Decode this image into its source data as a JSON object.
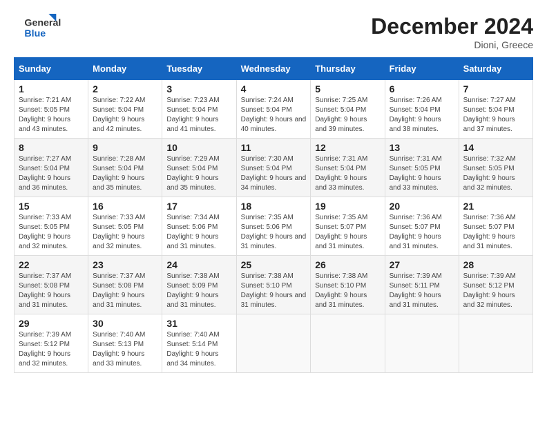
{
  "header": {
    "logo_general": "General",
    "logo_blue": "Blue",
    "month_title": "December 2024",
    "location": "Dioni, Greece"
  },
  "weekdays": [
    "Sunday",
    "Monday",
    "Tuesday",
    "Wednesday",
    "Thursday",
    "Friday",
    "Saturday"
  ],
  "weeks": [
    [
      {
        "day": "1",
        "sunrise": "7:21 AM",
        "sunset": "5:05 PM",
        "daylight": "9 hours and 43 minutes."
      },
      {
        "day": "2",
        "sunrise": "7:22 AM",
        "sunset": "5:04 PM",
        "daylight": "9 hours and 42 minutes."
      },
      {
        "day": "3",
        "sunrise": "7:23 AM",
        "sunset": "5:04 PM",
        "daylight": "9 hours and 41 minutes."
      },
      {
        "day": "4",
        "sunrise": "7:24 AM",
        "sunset": "5:04 PM",
        "daylight": "9 hours and 40 minutes."
      },
      {
        "day": "5",
        "sunrise": "7:25 AM",
        "sunset": "5:04 PM",
        "daylight": "9 hours and 39 minutes."
      },
      {
        "day": "6",
        "sunrise": "7:26 AM",
        "sunset": "5:04 PM",
        "daylight": "9 hours and 38 minutes."
      },
      {
        "day": "7",
        "sunrise": "7:27 AM",
        "sunset": "5:04 PM",
        "daylight": "9 hours and 37 minutes."
      }
    ],
    [
      {
        "day": "8",
        "sunrise": "7:27 AM",
        "sunset": "5:04 PM",
        "daylight": "9 hours and 36 minutes."
      },
      {
        "day": "9",
        "sunrise": "7:28 AM",
        "sunset": "5:04 PM",
        "daylight": "9 hours and 35 minutes."
      },
      {
        "day": "10",
        "sunrise": "7:29 AM",
        "sunset": "5:04 PM",
        "daylight": "9 hours and 35 minutes."
      },
      {
        "day": "11",
        "sunrise": "7:30 AM",
        "sunset": "5:04 PM",
        "daylight": "9 hours and 34 minutes."
      },
      {
        "day": "12",
        "sunrise": "7:31 AM",
        "sunset": "5:04 PM",
        "daylight": "9 hours and 33 minutes."
      },
      {
        "day": "13",
        "sunrise": "7:31 AM",
        "sunset": "5:05 PM",
        "daylight": "9 hours and 33 minutes."
      },
      {
        "day": "14",
        "sunrise": "7:32 AM",
        "sunset": "5:05 PM",
        "daylight": "9 hours and 32 minutes."
      }
    ],
    [
      {
        "day": "15",
        "sunrise": "7:33 AM",
        "sunset": "5:05 PM",
        "daylight": "9 hours and 32 minutes."
      },
      {
        "day": "16",
        "sunrise": "7:33 AM",
        "sunset": "5:05 PM",
        "daylight": "9 hours and 32 minutes."
      },
      {
        "day": "17",
        "sunrise": "7:34 AM",
        "sunset": "5:06 PM",
        "daylight": "9 hours and 31 minutes."
      },
      {
        "day": "18",
        "sunrise": "7:35 AM",
        "sunset": "5:06 PM",
        "daylight": "9 hours and 31 minutes."
      },
      {
        "day": "19",
        "sunrise": "7:35 AM",
        "sunset": "5:07 PM",
        "daylight": "9 hours and 31 minutes."
      },
      {
        "day": "20",
        "sunrise": "7:36 AM",
        "sunset": "5:07 PM",
        "daylight": "9 hours and 31 minutes."
      },
      {
        "day": "21",
        "sunrise": "7:36 AM",
        "sunset": "5:07 PM",
        "daylight": "9 hours and 31 minutes."
      }
    ],
    [
      {
        "day": "22",
        "sunrise": "7:37 AM",
        "sunset": "5:08 PM",
        "daylight": "9 hours and 31 minutes."
      },
      {
        "day": "23",
        "sunrise": "7:37 AM",
        "sunset": "5:08 PM",
        "daylight": "9 hours and 31 minutes."
      },
      {
        "day": "24",
        "sunrise": "7:38 AM",
        "sunset": "5:09 PM",
        "daylight": "9 hours and 31 minutes."
      },
      {
        "day": "25",
        "sunrise": "7:38 AM",
        "sunset": "5:10 PM",
        "daylight": "9 hours and 31 minutes."
      },
      {
        "day": "26",
        "sunrise": "7:38 AM",
        "sunset": "5:10 PM",
        "daylight": "9 hours and 31 minutes."
      },
      {
        "day": "27",
        "sunrise": "7:39 AM",
        "sunset": "5:11 PM",
        "daylight": "9 hours and 31 minutes."
      },
      {
        "day": "28",
        "sunrise": "7:39 AM",
        "sunset": "5:12 PM",
        "daylight": "9 hours and 32 minutes."
      }
    ],
    [
      {
        "day": "29",
        "sunrise": "7:39 AM",
        "sunset": "5:12 PM",
        "daylight": "9 hours and 32 minutes."
      },
      {
        "day": "30",
        "sunrise": "7:40 AM",
        "sunset": "5:13 PM",
        "daylight": "9 hours and 33 minutes."
      },
      {
        "day": "31",
        "sunrise": "7:40 AM",
        "sunset": "5:14 PM",
        "daylight": "9 hours and 34 minutes."
      },
      null,
      null,
      null,
      null
    ]
  ]
}
